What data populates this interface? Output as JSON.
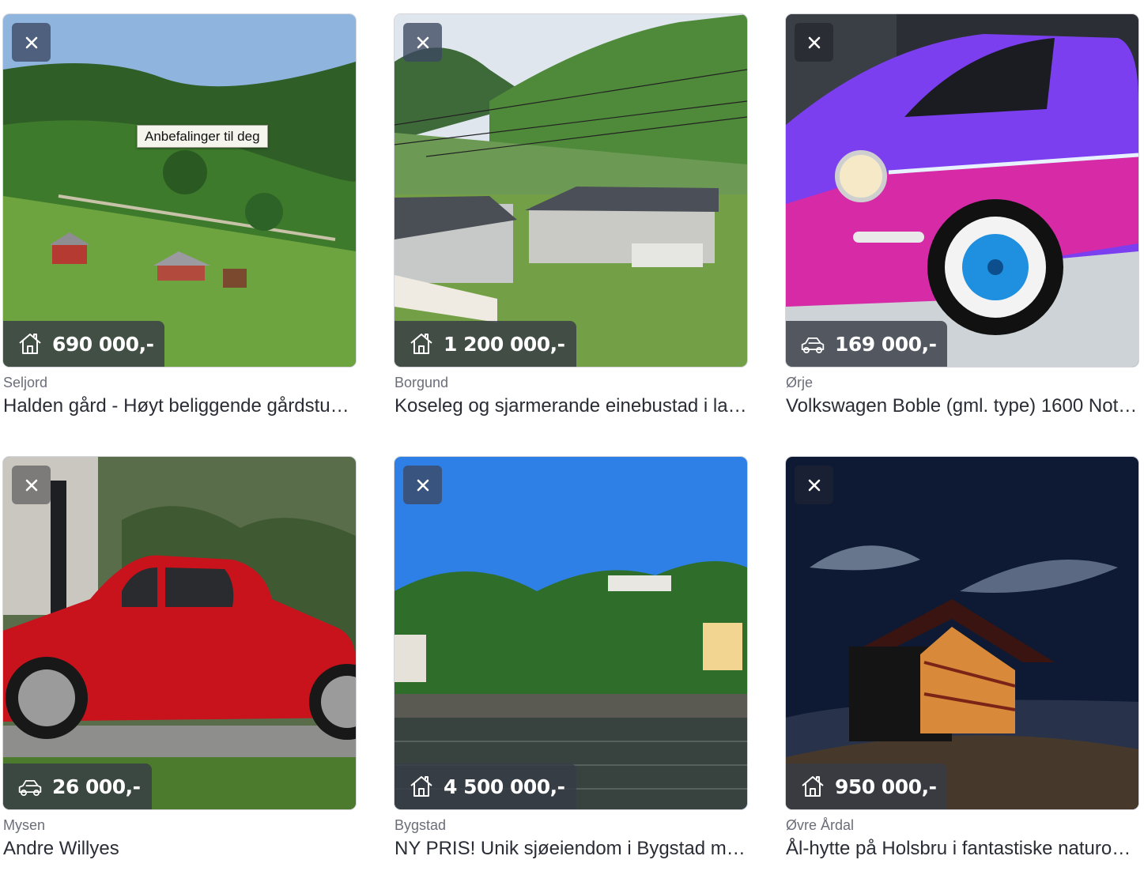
{
  "tooltip": "Anbefalinger til deg",
  "cards": [
    {
      "location": "Seljord",
      "title": "Halden gård - Høyt beliggende gårdstun ...",
      "price": "690 000,-",
      "type_icon": "house-icon"
    },
    {
      "location": "Borgund",
      "title": "Koseleg og sjarmerande einebustad i lan...",
      "price": "1 200 000,-",
      "type_icon": "house-icon"
    },
    {
      "location": "Ørje",
      "title": "Volkswagen Boble (gml. type) 1600 Notc...",
      "price": "169 000,-",
      "type_icon": "car-icon"
    },
    {
      "location": "Mysen",
      "title": "Andre Willyes",
      "price": "26 000,-",
      "type_icon": "car-icon"
    },
    {
      "location": "Bygstad",
      "title": "NY PRIS! Unik sjøeiendom i Bygstad me...",
      "price": "4 500 000,-",
      "type_icon": "house-icon"
    },
    {
      "location": "Øvre Årdal",
      "title": "Ål-hytte på Holsbru i fantastiske naturom...",
      "price": "950 000,-",
      "type_icon": "house-icon"
    }
  ]
}
